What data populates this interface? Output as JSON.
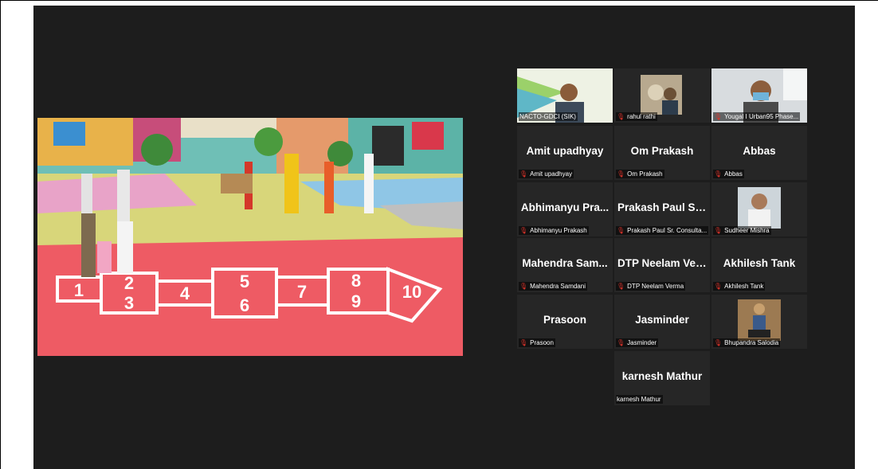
{
  "gallery": {
    "participants": [
      {
        "name": "NACTO-GDCI (SIK)",
        "display": "",
        "muted": false,
        "video": true
      },
      {
        "name": "rahul rathi",
        "display": "",
        "muted": true,
        "video": true
      },
      {
        "name": "Yougal  I  Urban95 Phase...",
        "display": "",
        "muted": true,
        "video": true
      },
      {
        "name": "Amit upadhyay",
        "display": "Amit upadhyay",
        "muted": true,
        "video": false
      },
      {
        "name": "Om Prakash",
        "display": "Om Prakash",
        "muted": true,
        "video": false
      },
      {
        "name": "Abbas",
        "display": "Abbas",
        "muted": true,
        "video": false
      },
      {
        "name": "Abhimanyu Prakash",
        "display": "Abhimanyu  Pra...",
        "muted": true,
        "video": false
      },
      {
        "name": "Prakash Paul Sr. Consulta...",
        "display": "Prakash Paul Sr....",
        "muted": true,
        "video": false
      },
      {
        "name": "Sudheer Mishra",
        "display": "",
        "muted": true,
        "video": true
      },
      {
        "name": "Mahendra Samdani",
        "display": "Mahendra  Sam...",
        "muted": true,
        "video": false
      },
      {
        "name": "DTP Neelam Verma",
        "display": "DTP Neelam Ver...",
        "muted": true,
        "video": false
      },
      {
        "name": "Akhilesh Tank",
        "display": "Akhilesh Tank",
        "muted": true,
        "video": false
      },
      {
        "name": "Prasoon",
        "display": "Prasoon",
        "muted": true,
        "video": false
      },
      {
        "name": "Jasminder",
        "display": "Jasminder",
        "muted": true,
        "video": false
      },
      {
        "name": "Bhupandra Salodia",
        "display": "",
        "muted": true,
        "video": true
      },
      {
        "name": "karnesh Mathur",
        "display": "karnesh Mathur",
        "muted": false,
        "video": false
      }
    ]
  },
  "shared_screen": {
    "hopscotch_numbers": [
      "1",
      "2",
      "3",
      "4",
      "5",
      "6",
      "7",
      "8",
      "9",
      "10"
    ]
  },
  "colors": {
    "background": "#1d1d1d",
    "tile": "#262626",
    "active_speaker": "#d6f04a",
    "muted_icon": "#e0332a"
  },
  "icons": {
    "muted": "microphone-muted-icon"
  }
}
